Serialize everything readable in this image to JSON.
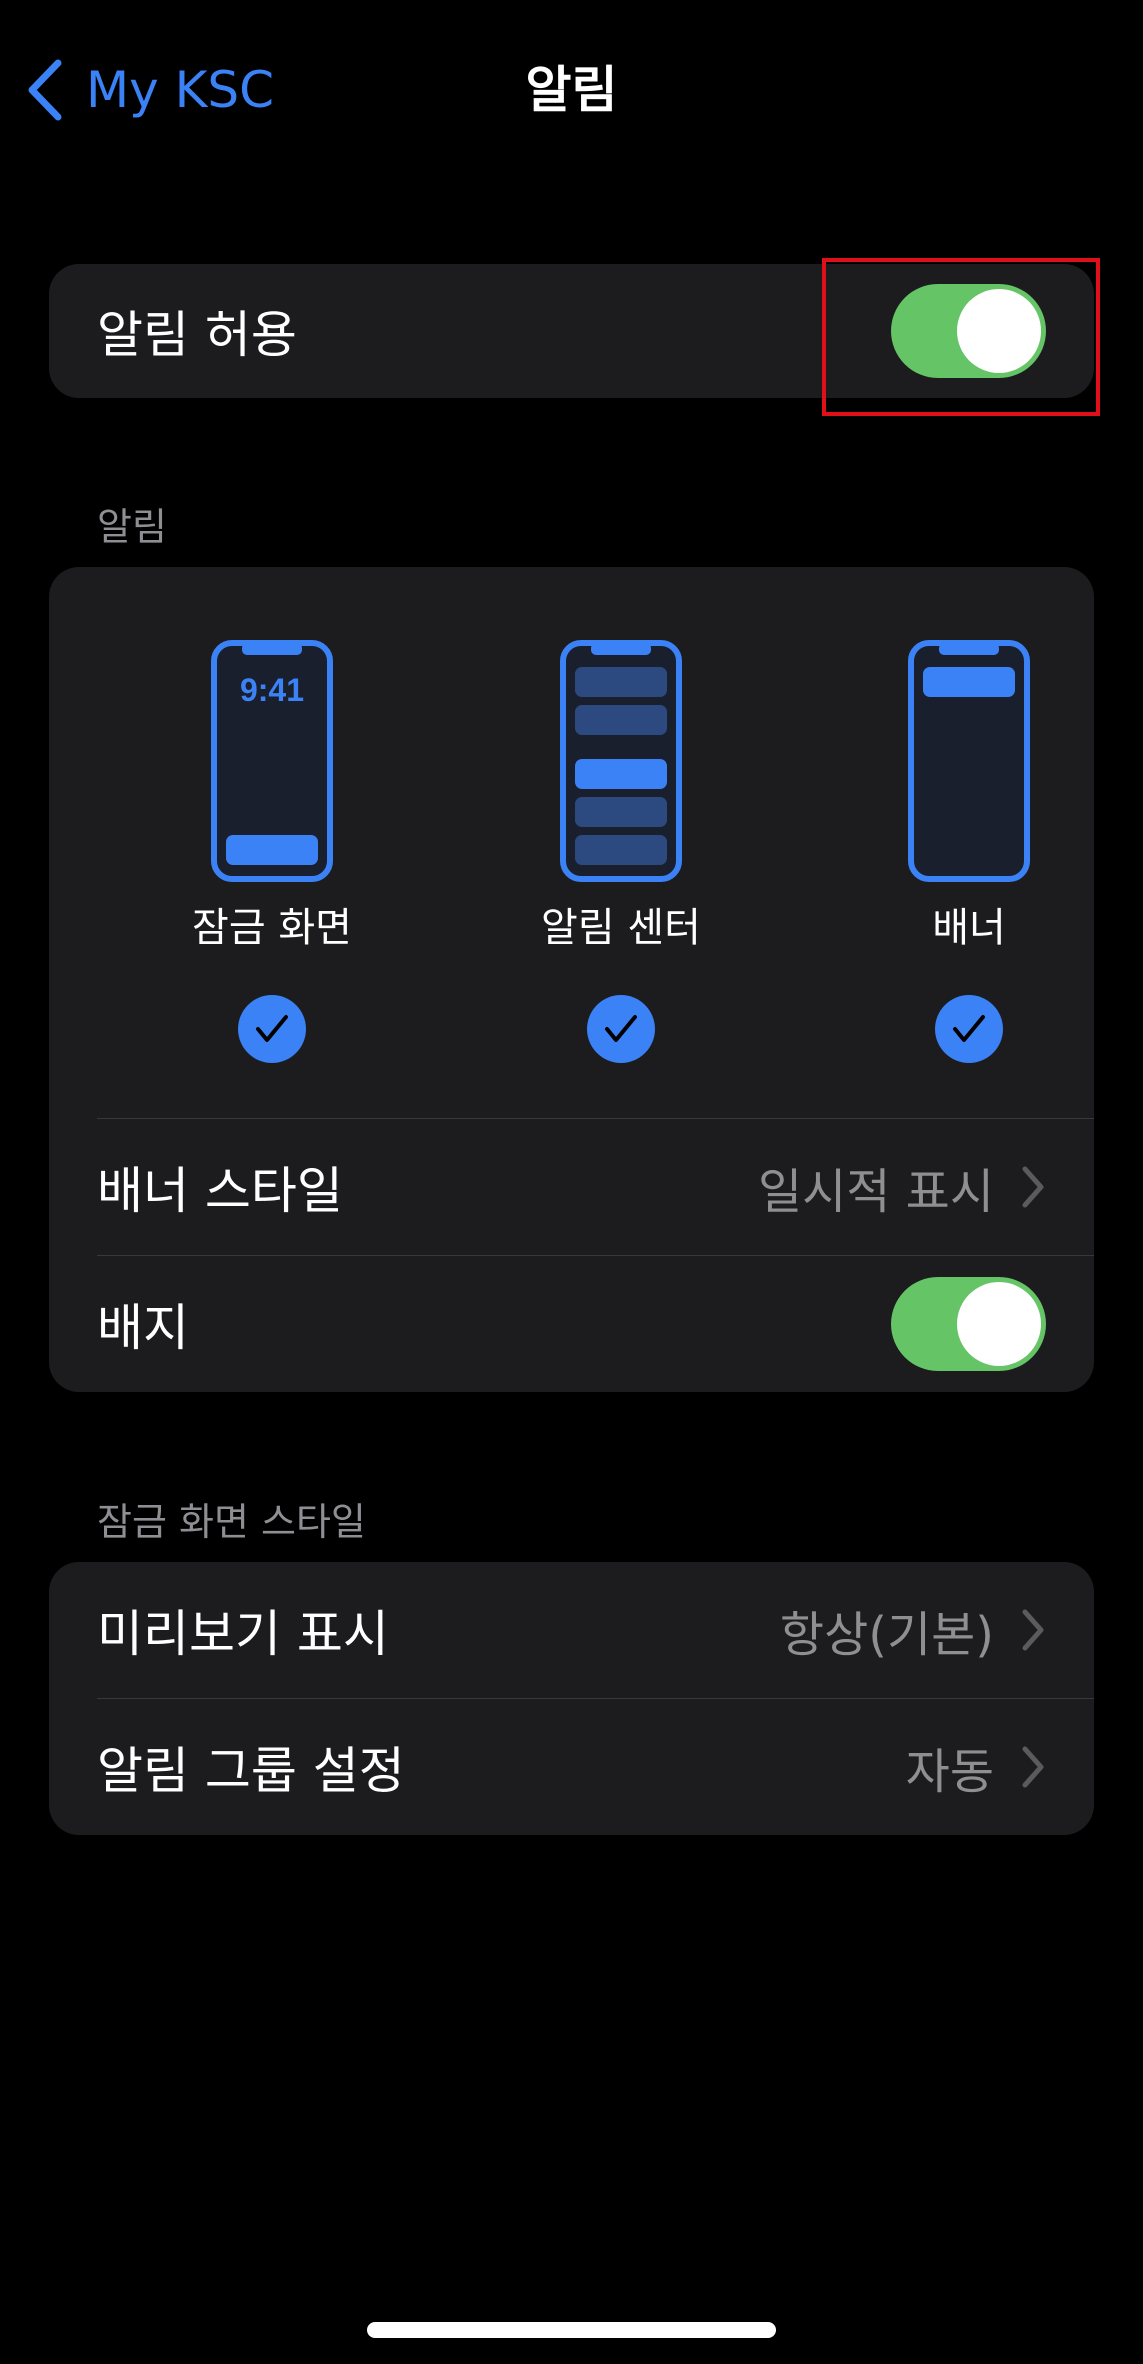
{
  "nav": {
    "back_label": "My KSC",
    "title": "알림"
  },
  "allow_notifications": {
    "label": "알림 허용",
    "enabled": true
  },
  "alerts_section": {
    "header": "알림",
    "styles": [
      {
        "label": "잠금 화면",
        "checked": true,
        "clock": "9:41"
      },
      {
        "label": "알림 센터",
        "checked": true
      },
      {
        "label": "배너",
        "checked": true
      }
    ],
    "banner_style": {
      "label": "배너 스타일",
      "value": "일시적 표시"
    },
    "badges": {
      "label": "배지",
      "enabled": true
    }
  },
  "lock_screen_section": {
    "header": "잠금 화면 스타일",
    "show_previews": {
      "label": "미리보기 표시",
      "value": "항상(기본)"
    },
    "grouping": {
      "label": "알림 그룹 설정",
      "value": "자동"
    }
  },
  "colors": {
    "accent": "#3b82f6",
    "toggle_on": "#65c466",
    "card_bg": "#1c1c1e",
    "highlight": "#e0101a"
  }
}
